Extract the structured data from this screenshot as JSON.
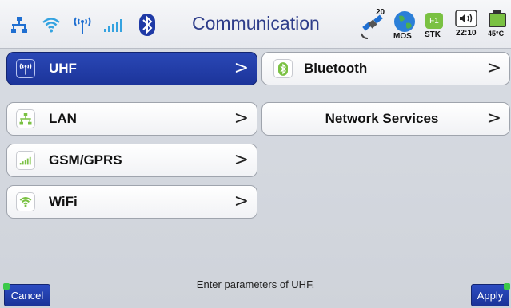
{
  "header": {
    "title": "Communication",
    "satellite_count": "20",
    "mos_label": "MOS",
    "stk_key": "F1",
    "stk_label": "STK",
    "time": "22:10",
    "temperature": "45°C"
  },
  "status_icons": [
    "lan-icon",
    "wifi-icon",
    "uhf-antenna-icon",
    "signal-bars-icon",
    "bluetooth-icon",
    "satellite-icon",
    "globe-icon",
    "speaker-icon",
    "battery-icon"
  ],
  "menu": {
    "left": [
      {
        "label": "UHF",
        "icon": "uhf-antenna-icon",
        "selected": true
      },
      {
        "label": "LAN",
        "icon": "lan-icon",
        "selected": false
      },
      {
        "label": "GSM/GPRS",
        "icon": "signal-bars-icon",
        "selected": false
      },
      {
        "label": "WiFi",
        "icon": "wifi-icon",
        "selected": false
      }
    ],
    "right": [
      {
        "label": "Bluetooth",
        "icon": "bluetooth-icon"
      },
      {
        "label": "Network Services"
      }
    ],
    "chevron": ">"
  },
  "footer": {
    "hint": "Enter parameters of UHF.",
    "cancel_label": "Cancel",
    "apply_label": "Apply"
  },
  "colors": {
    "accent": "#1f3aa6",
    "title": "#2e3d8a",
    "icon_green": "#7ac142",
    "icon_blue": "#1f6fd1"
  }
}
